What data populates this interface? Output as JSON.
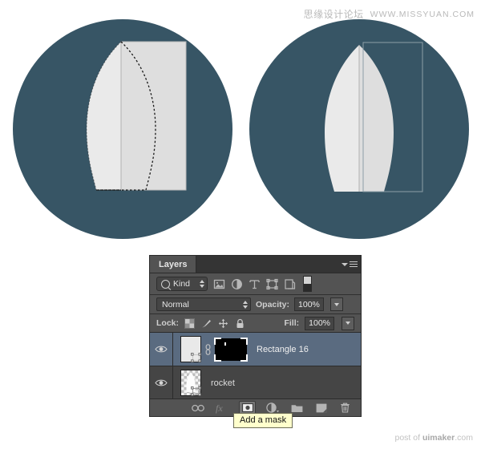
{
  "watermark": {
    "top_cn": "思缘设计论坛",
    "top_en": "WWW.MISSYUAN.COM",
    "bottom_prefix": "post of ",
    "bottom_brand": "uimaker",
    "bottom_suffix": ".com"
  },
  "illustrations": {
    "left": {
      "name": "rocket-body-with-selection",
      "circle_color": "#375565",
      "shape_fill_light": "#e9e9e9",
      "shape_fill_dark": "#dcdcdc",
      "selection": "marching-ants"
    },
    "right": {
      "name": "rocket-body-masked",
      "circle_color": "#375565",
      "shape_fill_light": "#e9e9e9",
      "shape_fill_dark": "#dcdcdc",
      "selection": "bounding-box"
    }
  },
  "panel": {
    "tab_label": "Layers",
    "menu_icon": "panel-menu-icon",
    "filter": {
      "search_icon": "search-icon",
      "kind_label": "Kind",
      "stepper_icon": "updown-stepper-icon",
      "type_filters": [
        {
          "name": "filter-pixel-icon",
          "title": "Pixel layers"
        },
        {
          "name": "filter-adjustment-icon",
          "title": "Adjustment layers"
        },
        {
          "name": "filter-type-icon",
          "title": "Type layers"
        },
        {
          "name": "filter-shape-icon",
          "title": "Shape layers"
        },
        {
          "name": "filter-smartobject-icon",
          "title": "Smart objects"
        }
      ],
      "toggle_name": "filter-enable-toggle"
    },
    "blend": {
      "mode": "Normal",
      "opacity_label": "Opacity:",
      "opacity_value": "100%"
    },
    "lock": {
      "label": "Lock:",
      "icons": [
        {
          "name": "lock-transparent-pixels-icon"
        },
        {
          "name": "lock-image-pixels-icon"
        },
        {
          "name": "lock-position-icon"
        },
        {
          "name": "lock-all-icon"
        }
      ],
      "fill_label": "Fill:",
      "fill_value": "100%"
    },
    "layers": [
      {
        "name": "Rectangle 16",
        "selected": true,
        "visible": true,
        "has_mask": true,
        "linked": true,
        "thumb_type": "vector-shape"
      },
      {
        "name": "rocket",
        "selected": false,
        "visible": true,
        "has_mask": false,
        "linked": false,
        "thumb_type": "transparent-shape"
      }
    ],
    "bottom_buttons": [
      {
        "name": "link-layers-button",
        "icon": "link-icon",
        "state": "normal"
      },
      {
        "name": "layer-style-button",
        "icon": "fx-icon",
        "state": "disabled"
      },
      {
        "name": "add-mask-button",
        "icon": "add-mask-icon",
        "state": "pressed"
      },
      {
        "name": "new-adjustment-layer-button",
        "icon": "half-circle-icon",
        "state": "normal"
      },
      {
        "name": "new-group-button",
        "icon": "folder-icon",
        "state": "normal"
      },
      {
        "name": "new-layer-button",
        "icon": "new-layer-icon",
        "state": "normal"
      },
      {
        "name": "delete-layer-button",
        "icon": "trash-icon",
        "state": "normal"
      }
    ],
    "tooltip": "Add a mask",
    "colors": {
      "panel_bg": "#535353",
      "list_bg": "#454545",
      "selected_row": "#5a6b80",
      "tab_bar": "#343434"
    }
  }
}
